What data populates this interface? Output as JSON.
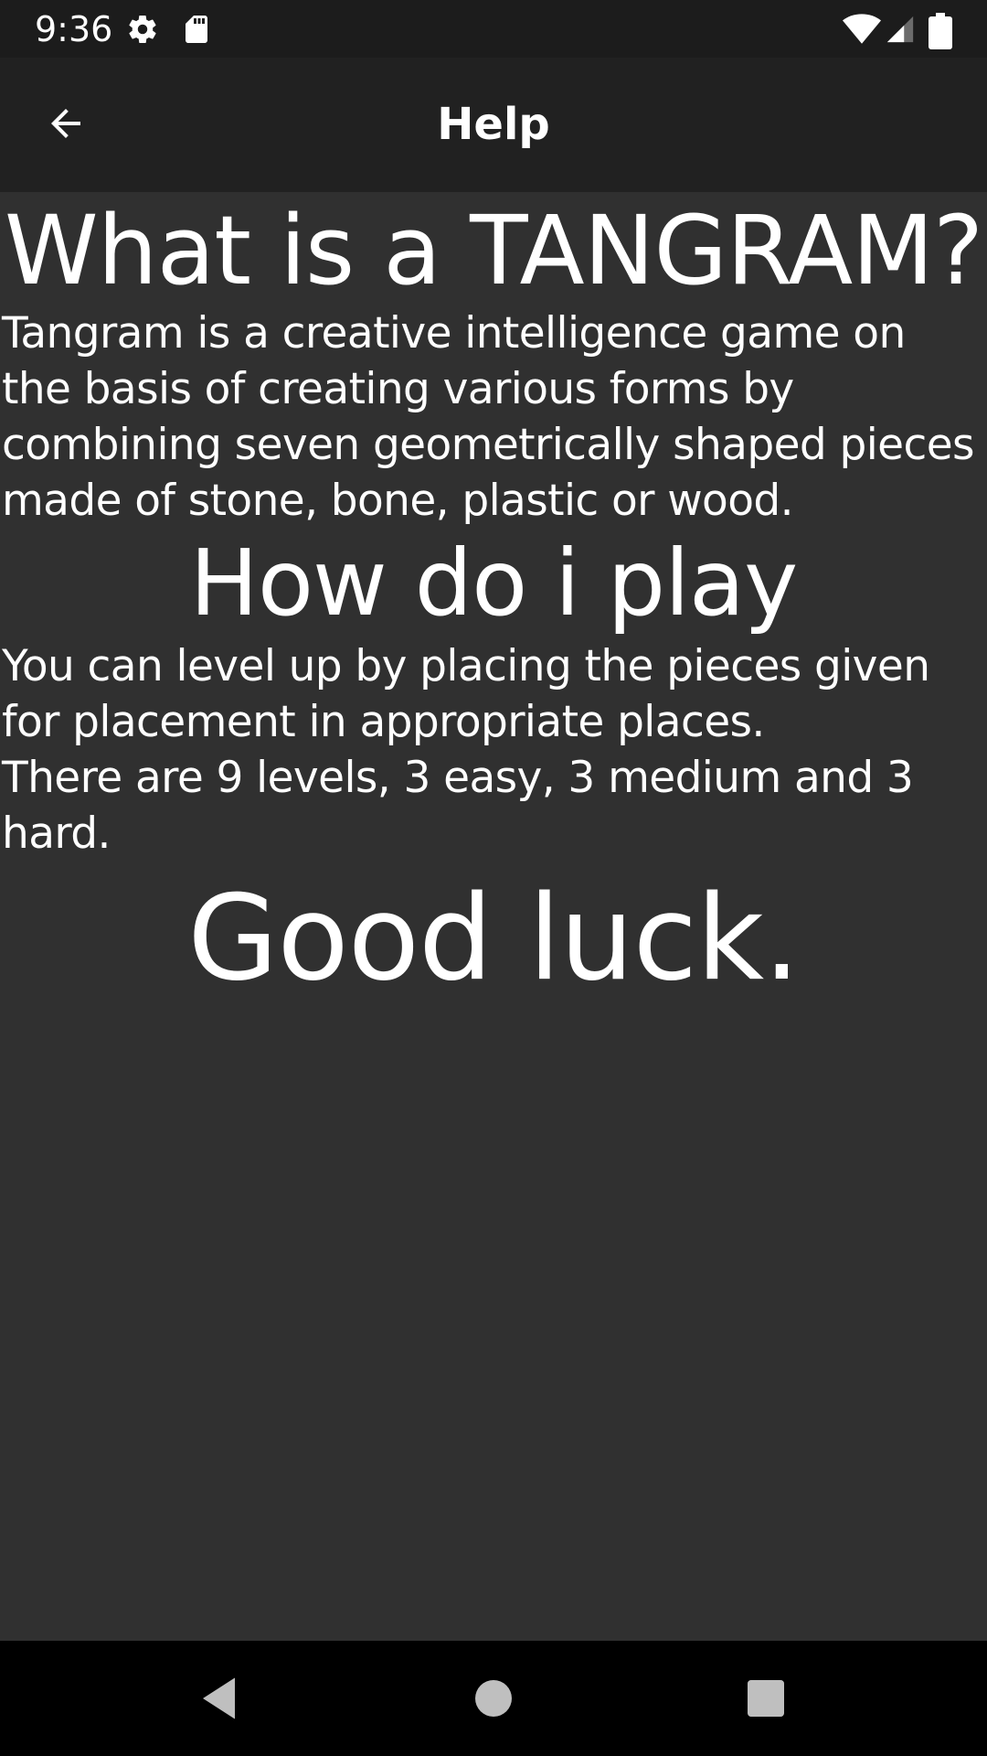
{
  "status_bar": {
    "time": "9:36",
    "icons": [
      "settings-icon",
      "sd-card-icon",
      "wifi-icon",
      "signal-icon",
      "battery-icon"
    ]
  },
  "app_bar": {
    "title": "Help",
    "back_icon": "arrow-back-icon"
  },
  "content": {
    "heading_what": "What is a TANGRAM?",
    "paragraph_what": "Tangram is a creative intelligence game on\nthe basis of creating various forms by\ncombining seven geometrically shaped pieces\nmade of stone, bone, plastic or wood.",
    "heading_how": "How do i play",
    "paragraph_how": "You can level up by placing the pieces given\nfor placement in appropriate places.\nThere are 9 levels, 3 easy, 3 medium and 3\nhard.",
    "closing": "Good luck."
  },
  "nav_bar": {
    "buttons": [
      "back-triangle-icon",
      "home-circle-icon",
      "recents-square-icon"
    ]
  },
  "colors": {
    "background": "#303030",
    "app_bar": "#212121",
    "status_bar": "#1c1c1c",
    "nav_bar": "#000000",
    "text": "#ffffff"
  }
}
